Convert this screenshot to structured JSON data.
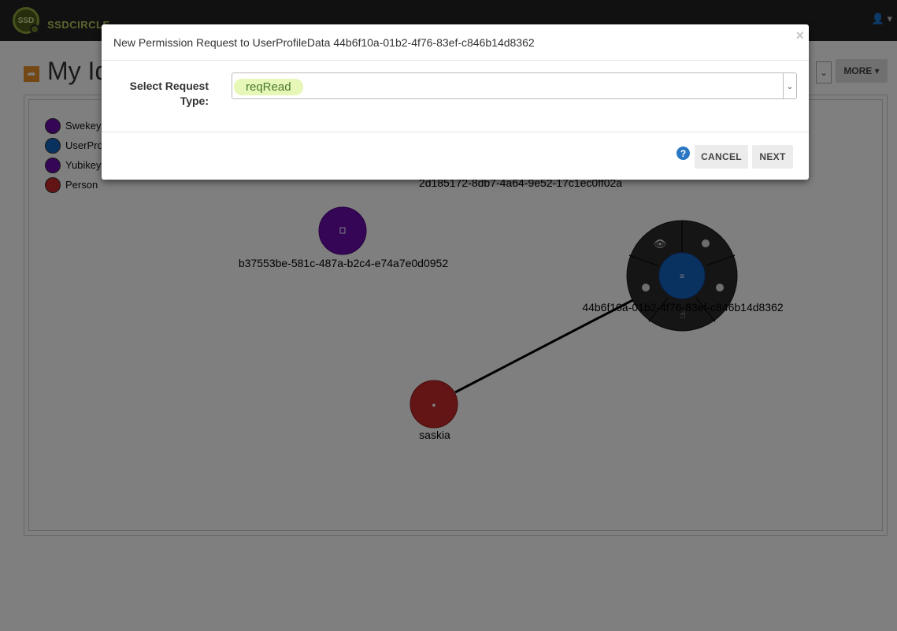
{
  "header": {
    "logo_text": "SSD",
    "brand": "SSDCIRCLE",
    "user_menu": "👤 ▾"
  },
  "page": {
    "title": "My Identity",
    "title_icon": "share-icon",
    "more_button": "MORE ▾",
    "select_caret": "⌄"
  },
  "legend": {
    "items": [
      {
        "label": "Swekey",
        "color": "#6a0dad"
      },
      {
        "label": "UserProfileData",
        "color": "#1565c0"
      },
      {
        "label": "Yubikey",
        "color": "#6a0dad"
      },
      {
        "label": "Person",
        "color": "#c62828"
      }
    ]
  },
  "graph": {
    "nodes": {
      "top_label": "2d185172-8db7-4a64-9e52-17c1ec0ff02a",
      "device_label": "b37553be-581c-487a-b2c4-e74a7e0d0952",
      "profile_label": "44b6f10a-01b2-4f76-83ef-c846b14d8362",
      "person_label": "saskia"
    },
    "radial_menu": [
      "eye-icon",
      "arrow-right-circle-icon",
      "plus-circle-icon",
      "hand-pointer-icon",
      "arrow-right-circle-icon"
    ]
  },
  "modal": {
    "title": "New Permission Request to UserProfileData 44b6f10a-01b2-4f76-83ef-c846b14d8362",
    "close": "×",
    "field_label": "Select Request Type:",
    "select_value": "reqRead",
    "select_caret": "⌄",
    "help": "?",
    "cancel": "CANCEL",
    "next": "NEXT"
  }
}
